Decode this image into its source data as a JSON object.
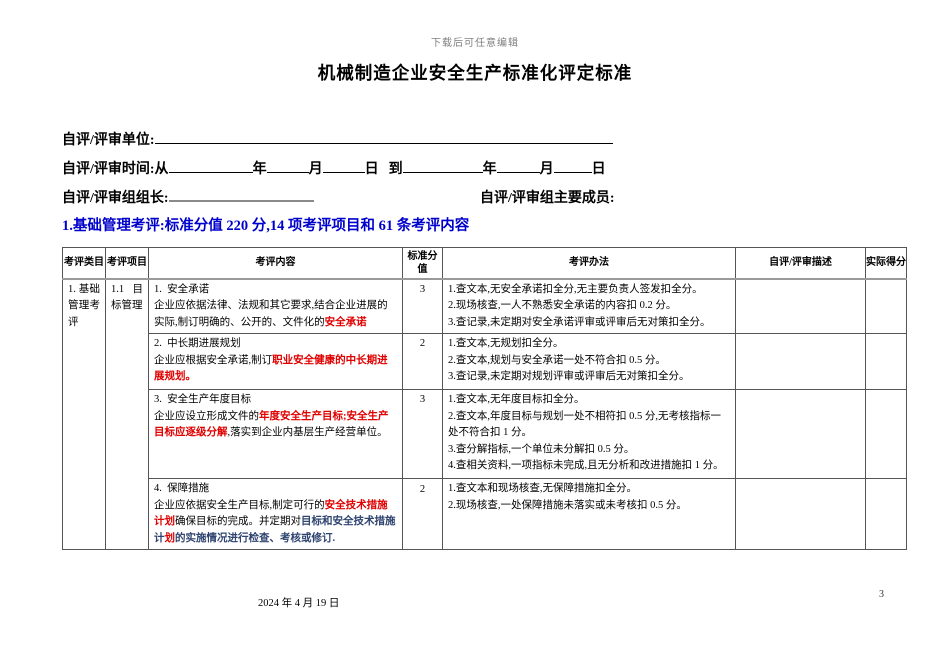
{
  "page": {
    "edit_note": "下载后可任意编辑",
    "title": "机械制造企业安全生产标准化评定标准",
    "footer_date": "2024 年 4 月 19 日",
    "page_number": "3"
  },
  "form": {
    "unit_label": "自评/评审单位:",
    "time_prefix": "自评/评审时间:从",
    "year": "年",
    "month": "月",
    "day": "日",
    "to": "到",
    "leader_label": "自评/评审组组长:",
    "members_label": "自评/评审组主要成员:"
  },
  "section": {
    "heading": "1.基础管理考评:标准分值 220 分,14 项考评项目和 61 条考评内容"
  },
  "table": {
    "headers": [
      "考评类目",
      "考评项目",
      "考评内容",
      "标准分值",
      "考评办法",
      "自评/评审描述",
      "实际得分"
    ],
    "category": "1. 基础管理考评",
    "project": "1.1目标管理",
    "rows": [
      {
        "title": "1.  安全承诺",
        "body": [
          {
            "t": "企业应依据法律、法规和其它要求,结合企业进展的实际,制订明确的、公开的、文件化的",
            "c": "k"
          },
          {
            "t": "安全承诺",
            "c": "r"
          }
        ],
        "score": "3",
        "score_valign": "middle",
        "methods": [
          "1.查文本,无安全承诺扣全分,无主要负责人签发扣全分。",
          "2.现场核查,一人不熟悉安全承诺的内容扣 0.2 分。",
          "3.查记录,未定期对安全承诺评审或评审后无对策扣全分。"
        ]
      },
      {
        "title": "2.  中长期进展规划",
        "body": [
          {
            "t": "企业应根据安全承诺,制订",
            "c": "k"
          },
          {
            "t": "职业安全健康的中长期进展规划。",
            "c": "r"
          }
        ],
        "score": "2",
        "score_valign": "middle",
        "methods": [
          "1.查文本,无规划扣全分。",
          "2.查文本,规划与安全承诺一处不符合扣 0.5 分。",
          "3.查记录,未定期对规划评审或评审后无对策扣全分。"
        ]
      },
      {
        "title": "3.  安全生产年度目标",
        "body": [
          {
            "t": "企业应设立形成文件的",
            "c": "k"
          },
          {
            "t": "年度安全生产目标;安全生产目标应逐级分解",
            "c": "r"
          },
          {
            "t": ",落实到企业内基层生产经营单位。",
            "c": "k"
          }
        ],
        "score": "3",
        "score_valign": "middle",
        "methods": [
          "1.查文本,无年度目标扣全分。",
          "2.查文本,年度目标与规划一处不相符扣 0.5 分,无考核指标一处不符合扣 1 分。",
          "3.查分解指标,一个单位未分解扣 0.5 分。",
          "4.查相关资料,一项指标未完成,且无分析和改进措施扣 1 分。"
        ]
      },
      {
        "title": "4.  保障措施",
        "body": [
          {
            "t": "企业应依据安全生产目标,制定可行的",
            "c": "k"
          },
          {
            "t": "安全技术措施计划",
            "c": "r"
          },
          {
            "t": "确保目标的完成。并定期对",
            "c": "k"
          },
          {
            "t": "目标和安全技术措施计",
            "c": "b"
          },
          {
            "t": "划",
            "c": "r"
          },
          {
            "t": "的实施情况进行检查、考核或修订.",
            "c": "b"
          }
        ],
        "score": "2",
        "score_valign": "top",
        "methods": [
          "1.查文本和现场核查,无保障措施扣全分。",
          "2.现场核查,一处保障措施未落实或未考核扣 0.5 分。"
        ]
      }
    ]
  },
  "colors": {
    "heading_blue": "#0000cc",
    "emphasis_red": "#e00000",
    "emphasis_dark_blue": "#2f4470",
    "note_gray": "#7f7f7f"
  }
}
